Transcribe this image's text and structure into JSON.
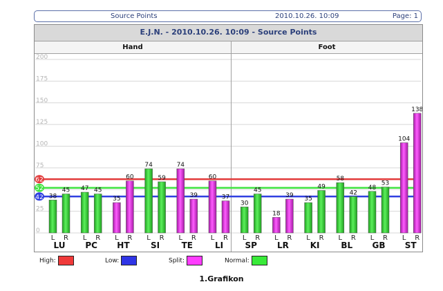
{
  "header": {
    "left": "Source Points",
    "center": "2010.10.26. 10:09",
    "right": "Page: 1"
  },
  "chart_data": {
    "type": "bar",
    "title": "E.J.N. - 2010.10.26. 10:09 - Source Points",
    "groups": [
      "Hand",
      "Foot"
    ],
    "ylim": [
      0,
      200
    ],
    "yticks": [
      0,
      25,
      50,
      75,
      100,
      125,
      150,
      175,
      200
    ],
    "meridians": [
      {
        "name": "LU",
        "group": "Hand",
        "L": 38,
        "R": 45,
        "type": "Normal"
      },
      {
        "name": "PC",
        "group": "Hand",
        "L": 47,
        "R": 45,
        "type": "Normal"
      },
      {
        "name": "HT",
        "group": "Hand",
        "L": 35,
        "R": 60,
        "type": "Split"
      },
      {
        "name": "SI",
        "group": "Hand",
        "L": 74,
        "R": 59,
        "type": "Normal"
      },
      {
        "name": "TE",
        "group": "Hand",
        "L": 74,
        "R": 39,
        "type": "Split"
      },
      {
        "name": "LI",
        "group": "Hand",
        "L": 60,
        "R": 37,
        "type": "Split"
      },
      {
        "name": "SP",
        "group": "Foot",
        "L": 30,
        "R": 45,
        "type": "Normal"
      },
      {
        "name": "LR",
        "group": "Foot",
        "L": 18,
        "R": 39,
        "type": "Split"
      },
      {
        "name": "KI",
        "group": "Foot",
        "L": 35,
        "R": 49,
        "type": "Normal"
      },
      {
        "name": "BL",
        "group": "Foot",
        "L": 58,
        "R": 42,
        "type": "Normal"
      },
      {
        "name": "GB",
        "group": "Foot",
        "L": 48,
        "R": 53,
        "type": "Normal"
      },
      {
        "name": "ST",
        "group": "Foot",
        "L": 104,
        "R": 138,
        "type": "Split"
      }
    ],
    "side_labels": [
      "L",
      "R"
    ],
    "reference_lines": [
      {
        "name": "High",
        "value": 62,
        "color": "#e23b3b"
      },
      {
        "name": "Normal",
        "value": 52,
        "color": "#3fe33f"
      },
      {
        "name": "Low",
        "value": 42,
        "color": "#2f3fe0"
      }
    ],
    "legend": [
      {
        "label": "High:",
        "color": "#f03a3a"
      },
      {
        "label": "Low:",
        "color": "#2f35e6"
      },
      {
        "label": "Split:",
        "color": "#ff3cff"
      },
      {
        "label": "Normal:",
        "color": "#39ea39"
      }
    ],
    "colors": {
      "Normal": "#35c935",
      "Split": "#d22fd2"
    }
  },
  "caption": "1.Grafikon"
}
